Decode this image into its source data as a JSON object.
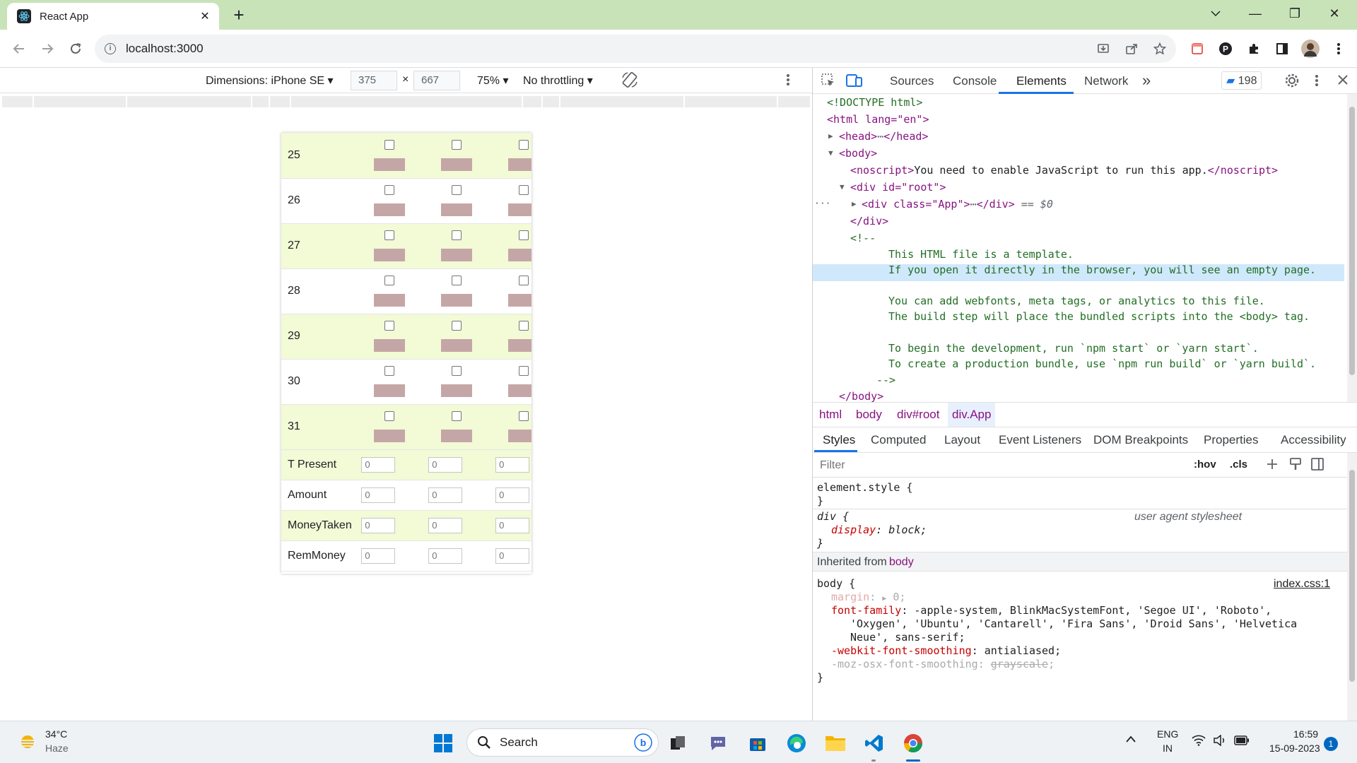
{
  "browser": {
    "tab_title": "React App",
    "tab_close": "✕",
    "new_tab": "+",
    "url": "localhost:3000",
    "win_minimize": "—",
    "win_restore": "❐",
    "win_close": "✕",
    "win_dropdown": "⌄"
  },
  "device_toolbar": {
    "dimensions_label": "Dimensions: iPhone SE",
    "width": "375",
    "times": "×",
    "height": "667",
    "zoom": "75%",
    "throttling": "No throttling"
  },
  "app": {
    "days": [
      "25",
      "26",
      "27",
      "28",
      "29",
      "30",
      "31"
    ],
    "summary_rows": [
      {
        "label": "T Present",
        "values": [
          "0",
          "0",
          "0"
        ]
      },
      {
        "label": "Amount",
        "values": [
          "0",
          "0",
          "0"
        ]
      },
      {
        "label": "MoneyTaken",
        "values": [
          "0",
          "0",
          "0"
        ]
      },
      {
        "label": "RemMoney",
        "values": [
          "0",
          "0",
          "0"
        ]
      }
    ],
    "colors": {
      "green_row": "#f2fad6",
      "bar": "#c5a6a6"
    }
  },
  "devtools": {
    "tabs": [
      "Sources",
      "Console",
      "Elements",
      "Network"
    ],
    "active_tab": "Elements",
    "more_tabs": "»",
    "issues_count": "198",
    "dom": {
      "doctype": "<!DOCTYPE html>",
      "html_open": "<html lang=\"en\">",
      "head": "<head>",
      "head_close": "</head>",
      "body_open": "<body>",
      "noscript_open": "<noscript>",
      "noscript_text": "You need to enable JavaScript to run this app.",
      "noscript_close": "</noscript>",
      "root_open": "<div id=\"root\">",
      "app_div": "<div class=\"App\">",
      "app_div_close": "</div>",
      "selected_marker": "== $0",
      "div_close": "</div>",
      "comment_open": "<!--",
      "comment_lines": [
        "This HTML file is a template.",
        "If you open it directly in the browser, you will see an empty page.",
        "",
        "You can add webfonts, meta tags, or analytics to this file.",
        "The build step will place the bundled scripts into the <body> tag.",
        "",
        "To begin the development, run `npm start` or `yarn start`.",
        "To create a production bundle, use `npm run build` or `yarn build`."
      ],
      "comment_close": "-->",
      "body_close": "</body>"
    },
    "breadcrumbs": [
      "html",
      "body",
      "div#root",
      "div.App"
    ],
    "styles_tabs": [
      "Styles",
      "Computed",
      "Layout",
      "Event Listeners",
      "DOM Breakpoints",
      "Properties",
      "Accessibility"
    ],
    "filter_placeholder": "Filter",
    "hov": ":hov",
    "cls": ".cls",
    "styles": {
      "element_style": "element.style {",
      "close_brace": "}",
      "div_selector": "div {",
      "user_agent": "user agent stylesheet",
      "display_prop": "display",
      "display_val": "block;",
      "inherited": "Inherited from",
      "inherited_from": "body",
      "body_selector": "body {",
      "source": "index.css:1",
      "margin_prop": "margin",
      "margin_val": "0;",
      "font_family_prop": "font-family",
      "font_family_val1": "-apple-system, BlinkMacSystemFont, 'Segoe UI', 'Roboto',",
      "font_family_val2": "'Oxygen', 'Ubuntu', 'Cantarell', 'Fira Sans', 'Droid Sans', 'Helvetica",
      "font_family_val3": "Neue', sans-serif;",
      "smoothing_prop": "-webkit-font-smoothing",
      "smoothing_val": "antialiased;",
      "moz_prop": "-moz-osx-font-smoothing",
      "moz_val": "grayscale"
    }
  },
  "taskbar": {
    "temperature": "34°C",
    "weather": "Haze",
    "search_label": "Search",
    "lang": "ENG",
    "region": "IN",
    "time": "16:59",
    "date": "15-09-2023",
    "notification_count": "1"
  }
}
